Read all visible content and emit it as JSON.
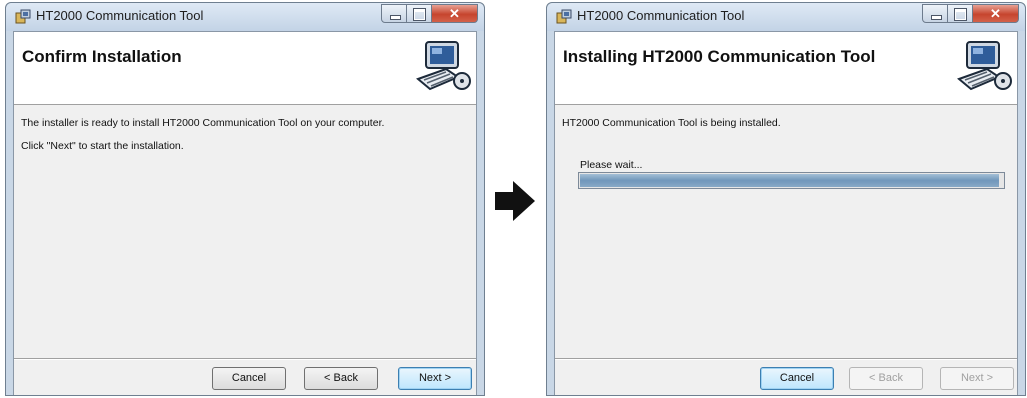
{
  "left_window": {
    "title": "HT2000 Communication Tool",
    "banner_title": "Confirm Installation",
    "message_1": "The installer is ready to install HT2000 Communication Tool on your computer.",
    "message_2": "Click \"Next\" to start the installation.",
    "buttons": {
      "cancel": "Cancel",
      "back": "< Back",
      "next": "Next >"
    }
  },
  "right_window": {
    "title": "HT2000 Communication Tool",
    "banner_title": "Installing HT2000 Communication Tool",
    "message_1": "HT2000 Communication Tool is being installed.",
    "progress_label": "Please wait...",
    "progress_fraction": 0.99,
    "buttons": {
      "cancel": "Cancel",
      "back": "< Back",
      "next": "Next >"
    }
  },
  "icons": {
    "app": "installer-app-icon",
    "banner": "computer-installer-icon",
    "arrow": "right-arrow-icon",
    "minimize": "minimize-icon",
    "maximize": "maximize-icon",
    "close": "close-icon"
  },
  "colors": {
    "close_button": "#c6452e",
    "progress_fill": "#7097bb",
    "default_button": "#3c7fb1"
  }
}
